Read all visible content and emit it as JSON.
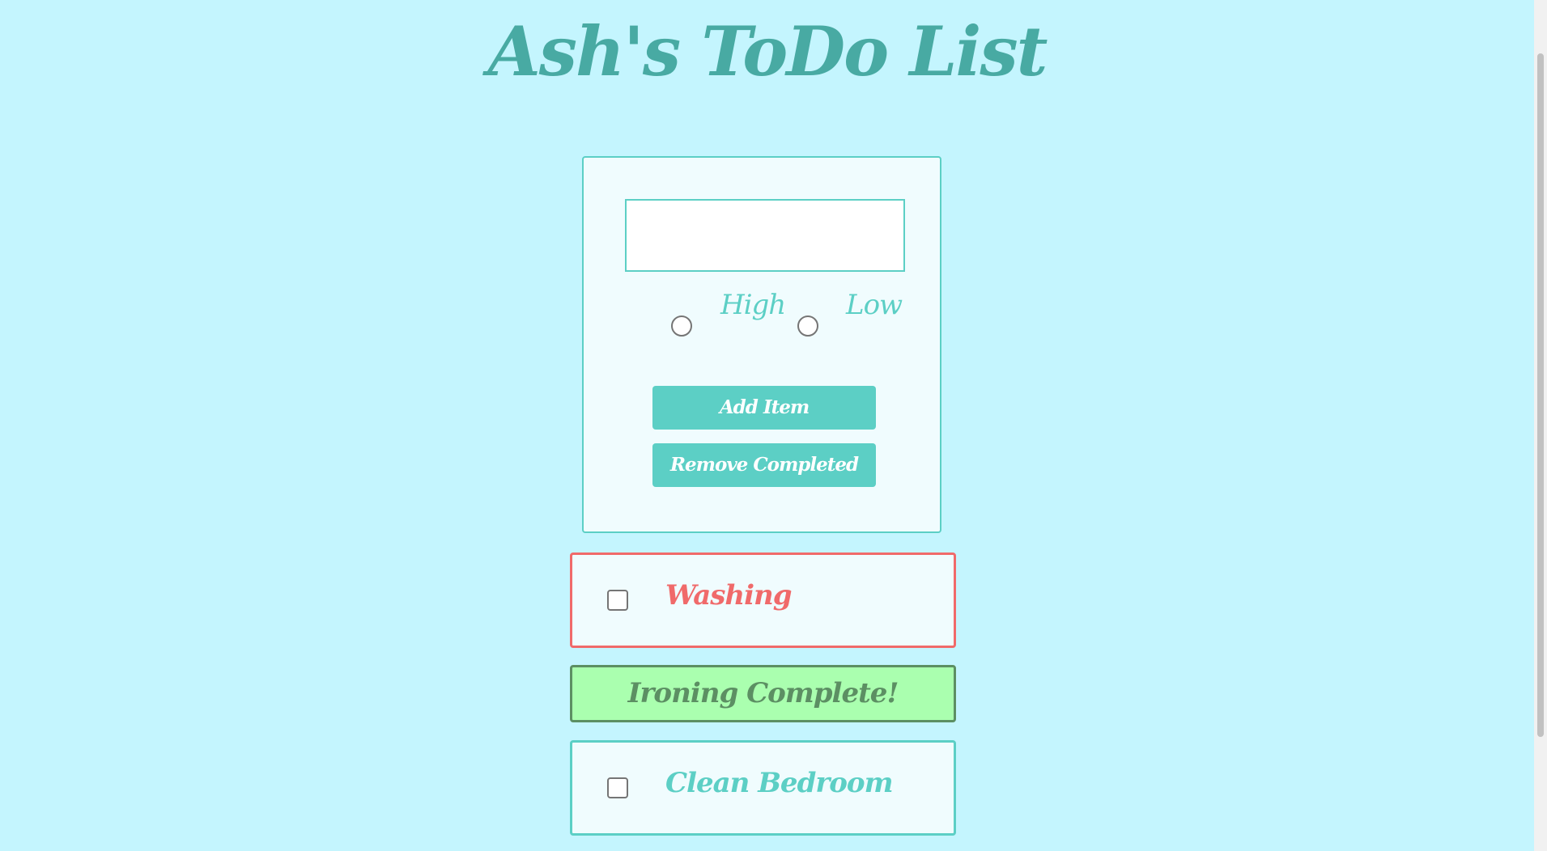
{
  "header": {
    "title": "Ash's ToDo List"
  },
  "form": {
    "input_value": "",
    "priority_options": [
      {
        "label": "High",
        "selected": false
      },
      {
        "label": "Low",
        "selected": false
      }
    ],
    "add_button_label": "Add Item",
    "remove_button_label": "Remove Completed"
  },
  "todo_items": [
    {
      "label": "Washing",
      "priority": "high",
      "completed": false
    },
    {
      "label": "Ironing Complete!",
      "priority": "low",
      "completed": true
    },
    {
      "label": "Clean Bedroom",
      "priority": "low",
      "completed": false
    }
  ],
  "colors": {
    "background": "#c4f5fe",
    "accent": "#5ccfc5",
    "title": "#48aaa3",
    "high_priority": "#f06a6a",
    "complete_bg": "#aaffaf",
    "complete_text": "#5c8f63",
    "card_bg": "#f0fcfe"
  }
}
